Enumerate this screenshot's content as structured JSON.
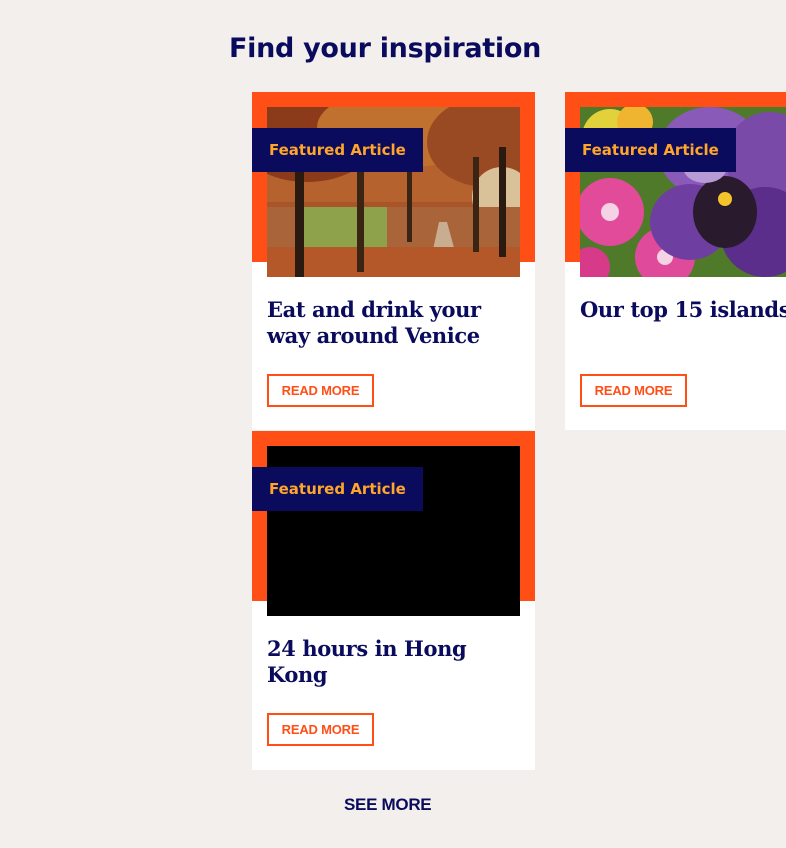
{
  "section": {
    "title": "Find your inspiration"
  },
  "cards": [
    {
      "badge": "Featured Article",
      "title": "Eat and drink your way around Venice",
      "read_more": "READ MORE",
      "image": "autumn-tree-avenue"
    },
    {
      "badge": "Featured Article",
      "title": "Our top 15 islands",
      "read_more": "READ MORE",
      "image": "pansy-flowers"
    },
    {
      "badge": "Featured Article",
      "title": "24 hours in Hong Kong",
      "read_more": "READ MORE",
      "image": "black-placeholder"
    }
  ],
  "see_more": "SEE MORE",
  "colors": {
    "accent": "#ff4f17",
    "navy": "#0b0b5e",
    "badge_text": "#ffa52a",
    "background": "#f3efed"
  }
}
